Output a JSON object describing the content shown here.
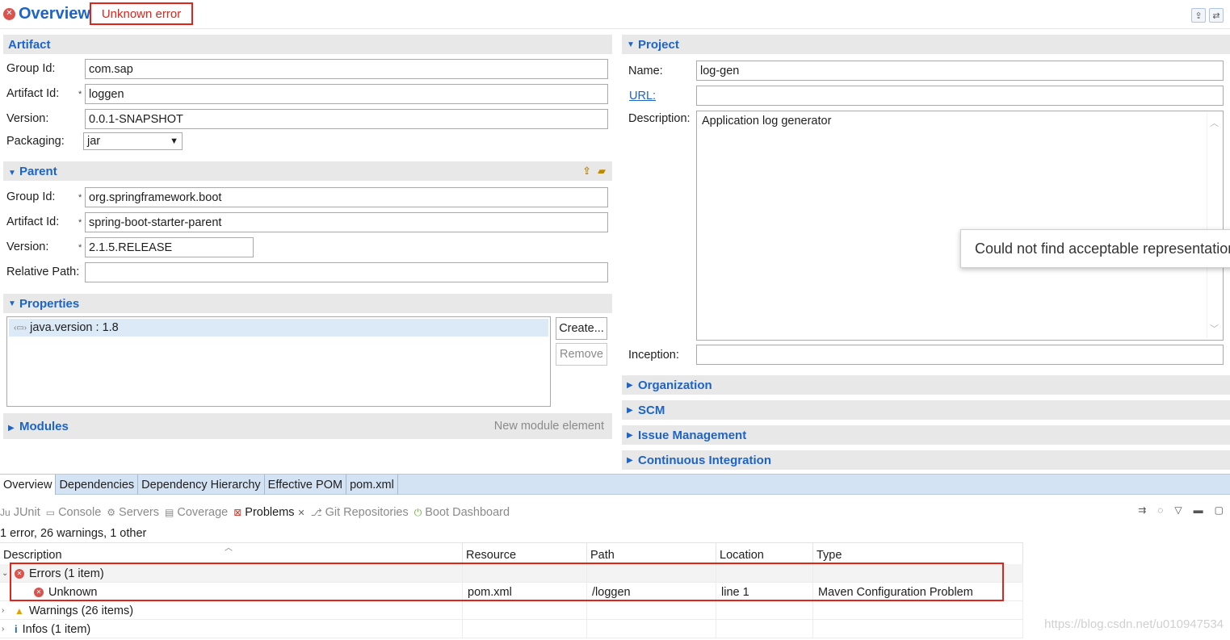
{
  "header": {
    "title": "Overview",
    "error_label": "Unknown error",
    "tool_icons": [
      "pom-refresh-icon",
      "sync-icon"
    ]
  },
  "artifact": {
    "section_title": "Artifact",
    "group_id_label": "Group Id:",
    "group_id": "com.sap",
    "artifact_id_label": "Artifact Id:",
    "artifact_id": "loggen",
    "version_label": "Version:",
    "version": "0.0.1-SNAPSHOT",
    "packaging_label": "Packaging:",
    "packaging": "jar"
  },
  "parent": {
    "section_title": "Parent",
    "group_id_label": "Group Id:",
    "group_id": "org.springframework.boot",
    "artifact_id_label": "Artifact Id:",
    "artifact_id": "spring-boot-starter-parent",
    "version_label": "Version:",
    "version": "2.1.5.RELEASE",
    "relative_path_label": "Relative Path:",
    "relative_path": ""
  },
  "properties": {
    "section_title": "Properties",
    "items": [
      "java.version : 1.8"
    ],
    "create_label": "Create...",
    "remove_label": "Remove"
  },
  "modules": {
    "section_title": "Modules",
    "new_element_label": "New module element"
  },
  "project": {
    "section_title": "Project",
    "name_label": "Name:",
    "name": "log-gen",
    "url_label": "URL:",
    "url": "",
    "description_label": "Description:",
    "description": "Application log generator",
    "inception_label": "Inception:",
    "inception": ""
  },
  "collapsed_sections": [
    "Organization",
    "SCM",
    "Issue Management",
    "Continuous Integration"
  ],
  "tooltip": "Could not find acceptable representation",
  "editor_tabs": [
    "Overview",
    "Dependencies",
    "Dependency Hierarchy",
    "Effective POM",
    "pom.xml"
  ],
  "view_tabs": [
    {
      "label": "JUnit",
      "icon": "junit-icon",
      "active": false
    },
    {
      "label": "Console",
      "icon": "console-icon",
      "active": false
    },
    {
      "label": "Servers",
      "icon": "servers-icon",
      "active": false
    },
    {
      "label": "Coverage",
      "icon": "coverage-icon",
      "active": false
    },
    {
      "label": "Problems",
      "icon": "problems-icon",
      "active": true
    },
    {
      "label": "Git Repositories",
      "icon": "git-icon",
      "active": false
    },
    {
      "label": "Boot Dashboard",
      "icon": "boot-dashboard-icon",
      "active": false
    }
  ],
  "problems": {
    "summary": "1 error, 26 warnings, 1 other",
    "columns": [
      "Description",
      "Resource",
      "Path",
      "Location",
      "Type"
    ],
    "rows": [
      {
        "kind": "group",
        "icon": "error-icon",
        "description": "Errors (1 item)",
        "expanded": true,
        "resource": "",
        "path": "",
        "location": "",
        "type": ""
      },
      {
        "kind": "item",
        "icon": "error-icon",
        "description": "Unknown",
        "resource": "pom.xml",
        "path": "/loggen",
        "location": "line 1",
        "type": "Maven Configuration Problem"
      },
      {
        "kind": "group",
        "icon": "warning-icon",
        "description": "Warnings (26 items)",
        "expanded": false,
        "resource": "",
        "path": "",
        "location": "",
        "type": ""
      },
      {
        "kind": "group",
        "icon": "info-icon",
        "description": "Infos (1 item)",
        "expanded": false,
        "resource": "",
        "path": "",
        "location": "",
        "type": ""
      }
    ]
  },
  "watermark": "https://blog.csdn.net/u010947534",
  "colors": {
    "accent": "#1d64c6",
    "error_highlight": "#e2231a",
    "section_bg": "#e8e8e8"
  }
}
